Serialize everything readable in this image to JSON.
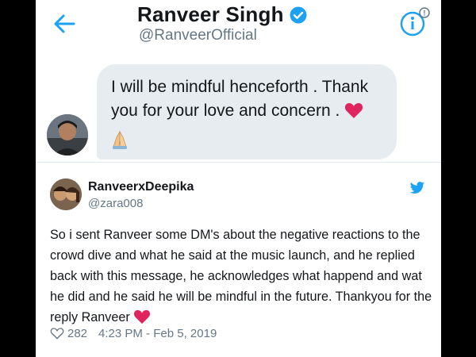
{
  "dm_header": {
    "name": "Ranveer Singh",
    "handle": "@RanveerOfficial",
    "icons": {
      "back": "back-arrow-icon",
      "verified": "verified-badge-icon",
      "info": "info-icon"
    }
  },
  "dm_message": {
    "text": "I will be mindful henceforth . Thank you for your love and concern .",
    "emojis": [
      "red-heart",
      "folded-hands"
    ]
  },
  "tweet": {
    "name": "RanveerxDeepika",
    "handle": "@zara008",
    "text": "So i sent Ranveer some DM's about the negative reactions to the crowd dive and what he said at the music launch, and he replied back with this message, he acknowledges what happend and wat he did and he said he will be mindful in the future. Thankyou for the reply Ranveer",
    "likes": "282",
    "timestamp": "4:23 PM - Feb 5, 2019",
    "icons": {
      "brand": "twitter-bird-icon",
      "like": "heart-outline-icon"
    }
  },
  "colors": {
    "accent": "#1da1f2",
    "bubble": "#e6ecf0",
    "heart": "#e0245e",
    "text": "#14171a",
    "muted": "#657786",
    "frame": "#000000"
  }
}
